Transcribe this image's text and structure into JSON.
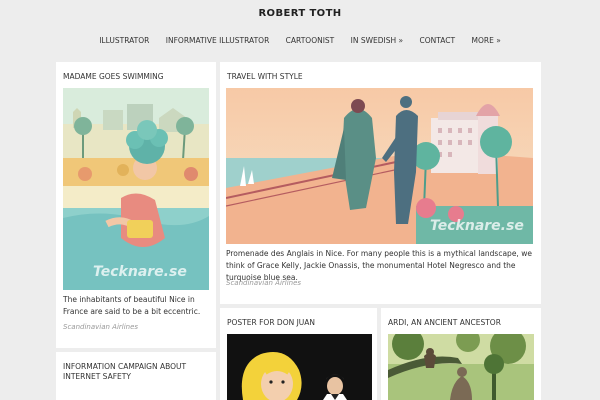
{
  "site": {
    "title": "ROBERT TOTH"
  },
  "nav": [
    "ILLUSTRATOR",
    "INFORMATIVE ILLUSTRATOR",
    "CARTOONIST",
    "IN SWEDISH »",
    "CONTACT",
    "MORE »"
  ],
  "cards": {
    "swimming": {
      "title": "MADAME GOES SWIMMING",
      "text": "The inhabitants of beautiful Nice in France are said to be a bit eccentric.",
      "source": "Scandinavian Airlines",
      "watermark": "Tecknare.se"
    },
    "travel": {
      "title": "TRAVEL WITH STYLE",
      "text": "Promenade des Anglais in Nice. For many people this is a mythical landscape, we think of Grace Kelly, Jackie Onassis, the monumental Hotel Negresco and the turquoise blue sea.",
      "source": "Scandinavian Airlines",
      "watermark": "Tecknare.se"
    },
    "donjuan": {
      "title": "POSTER FOR DON JUAN"
    },
    "ardi": {
      "title": "ARDI, AN ANCIENT ANCESTOR"
    },
    "internet": {
      "title": "INFORMATION CAMPAIGN ABOUT INTERNET SAFETY"
    }
  }
}
